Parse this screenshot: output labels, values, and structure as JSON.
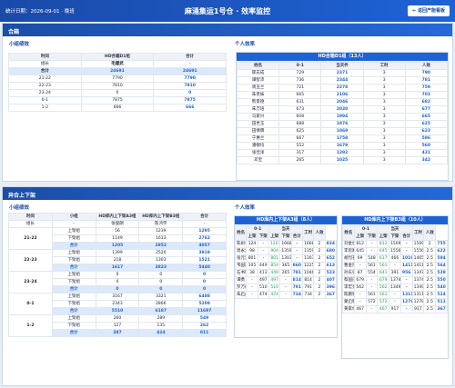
{
  "header": {
    "date_label": "统计日期：2026-09-01 · 晚班",
    "title": "麻涌集运1号仓 · 效率监控",
    "back_label": "← 返回产能看板"
  },
  "sec1": {
    "title": "合箱",
    "team_title": "小组绩效",
    "personal_title": "个人效率",
    "team_table": {
      "h1": [
        "时间",
        "HD合箱D1组",
        "合计"
      ],
      "h2": [
        "组长",
        "毛建武",
        "-"
      ],
      "total": [
        "合计",
        "24691",
        "24691"
      ],
      "rows": [
        [
          "21-22",
          "7790",
          "7790"
        ],
        [
          "22-23",
          "7810",
          "7810"
        ],
        [
          "23-24",
          "0",
          "0"
        ],
        [
          "0-1",
          "7875",
          "7875"
        ],
        [
          "1-2",
          "666",
          "666"
        ]
      ]
    },
    "personal": {
      "title": "HD合箱D1组（13人）",
      "cols": [
        "姓名",
        "0-1",
        "当天件",
        "工时",
        "人效"
      ],
      "rows": [
        [
          "郁志成",
          "729",
          "2371",
          "3",
          "790"
        ],
        [
          "谭智沛",
          "736",
          "2344",
          "3",
          "781"
        ],
        [
          "周玉兰",
          "721",
          "2278",
          "3",
          "759"
        ],
        [
          "朱贵妹",
          "665",
          "2106",
          "3",
          "702"
        ],
        [
          "熊景德",
          "631",
          "2046",
          "3",
          "682"
        ],
        [
          "朱万培",
          "673",
          "2030",
          "3",
          "677"
        ],
        [
          "马家兴",
          "608",
          "1994",
          "3",
          "665"
        ],
        [
          "田世玉",
          "688",
          "1876",
          "3",
          "625"
        ],
        [
          "田倩霖",
          "625",
          "1869",
          "3",
          "623"
        ],
        [
          "宁惠兰",
          "667",
          "1758",
          "3",
          "586"
        ],
        [
          "潘锡均",
          "552",
          "1679",
          "3",
          "560"
        ],
        [
          "张佳洋",
          "317",
          "1292",
          "3",
          "431"
        ],
        [
          "邓宝",
          "265",
          "1025",
          "3",
          "342"
        ]
      ]
    }
  },
  "sec2": {
    "title": "异合上下架",
    "team_title": "小组绩效",
    "personal_title": "个人效率",
    "team_table": {
      "h1": [
        "时间",
        "小组",
        "HD库内上下架A3组",
        "HD库内上下架B3组",
        "合计"
      ],
      "h2": [
        "组长",
        "-",
        "张俊朗",
        "陈鸿宇",
        "-"
      ],
      "blocks": [
        {
          "time": "21-22",
          "rows": [
            [
              "上架组",
              "56",
              "1239",
              "1295"
            ],
            [
              "下架组",
              "1149",
              "1613",
              "2762"
            ],
            [
              "合计",
              "1205",
              "2852",
              "4057"
            ]
          ]
        },
        {
          "time": "22-23",
          "rows": [
            [
              "上架组",
              "1399",
              "2520",
              "3919"
            ],
            [
              "下架组",
              "218",
              "1303",
              "1521"
            ],
            [
              "合计",
              "1617",
              "3823",
              "5440"
            ]
          ]
        },
        {
          "time": "23-24",
          "rows": [
            [
              "上架组",
              "0",
              "0",
              "0"
            ],
            [
              "下架组",
              "0",
              "0",
              "0"
            ],
            [
              "合计",
              "0",
              "0",
              "0"
            ]
          ]
        },
        {
          "time": "0-1",
          "rows": [
            [
              "上架组",
              "3167",
              "3321",
              "6488"
            ],
            [
              "下架组",
              "2343",
              "2866",
              "5209"
            ],
            [
              "合计",
              "5510",
              "6187",
              "11697"
            ]
          ]
        },
        {
          "time": "1-2",
          "rows": [
            [
              "上架组",
              "260",
              "289",
              "549"
            ],
            [
              "下架组",
              "127",
              "135",
              "262"
            ],
            [
              "合计",
              "387",
              "424",
              "811"
            ]
          ]
        }
      ]
    },
    "panelA": {
      "title": "HD库内上下架A3组（8人）",
      "group_head": [
        "0-1",
        "当天"
      ],
      "cols": [
        "姓名",
        "上架",
        "下架",
        "上架",
        "下架",
        "合计",
        "工时",
        "人效"
      ],
      "rows": [
        [
          "陈树林",
          "124",
          "-",
          "1207",
          "1668",
          "-",
          "1668",
          "2",
          "834"
        ],
        [
          "周永忠",
          "98",
          "-",
          "904",
          "1359",
          "-",
          "1359",
          "2",
          "680"
        ],
        [
          "张元凯",
          "801",
          "-",
          "801",
          "1303",
          "-",
          "1303",
          "2",
          "652"
        ],
        [
          "韦国鹏",
          "105",
          "449",
          "854",
          "365",
          "860",
          "1225",
          "2",
          "613"
        ],
        [
          "石书明",
          "38",
          "413",
          "449",
          "265",
          "781",
          "1046",
          "2",
          "523"
        ],
        [
          "谭勇",
          "-",
          "497",
          "497",
          "-",
          "814",
          "814",
          "2",
          "407"
        ],
        [
          "罗万毅",
          "-",
          "510",
          "510",
          "-",
          "791",
          "791",
          "2",
          "396"
        ],
        [
          "朱启虎",
          "-",
          "474",
          "474",
          "-",
          "734",
          "734",
          "2",
          "367"
        ]
      ]
    },
    "panelB": {
      "title": "HD库内上下架B3组（10人）",
      "group_head": [
        "0-1",
        "当天"
      ],
      "cols": [
        "姓名",
        "上架",
        "下架",
        "上架",
        "下架",
        "合计",
        "工时",
        "人效"
      ],
      "rows": [
        [
          "刘金俊",
          "812",
          "-",
          "812",
          "1509",
          "-",
          "1509",
          "2",
          "755"
        ],
        [
          "李思卿",
          "645",
          "-",
          "645",
          "1556",
          "-",
          "1556",
          "2.5",
          "622"
        ],
        [
          "胡烈石",
          "69",
          "548",
          "617",
          "466",
          "1019",
          "1465",
          "2.5",
          "594"
        ],
        [
          "曹金阳",
          "-",
          "561",
          "561",
          "-",
          "1411",
          "1411",
          "2.5",
          "564"
        ],
        [
          "孙东强",
          "87",
          "554",
          "641",
          "391",
          "956",
          "1347",
          "2.5",
          "539"
        ],
        [
          "蔡国庆",
          "679",
          "-",
          "679",
          "1374",
          "-",
          "1374",
          "2.5",
          "550"
        ],
        [
          "李宏亮",
          "562",
          "-",
          "562",
          "1349",
          "-",
          "1349",
          "2.5",
          "540"
        ],
        [
          "陈鹏程",
          "-",
          "561",
          "561",
          "-",
          "1311",
          "1311",
          "2.5",
          "524"
        ],
        [
          "蒙启明",
          "-",
          "572",
          "572",
          "-",
          "1278",
          "1278",
          "2.5",
          "511"
        ],
        [
          "黄家佑",
          "467",
          "-",
          "467",
          "917",
          "-",
          "917",
          "2.5",
          "367"
        ]
      ]
    }
  }
}
